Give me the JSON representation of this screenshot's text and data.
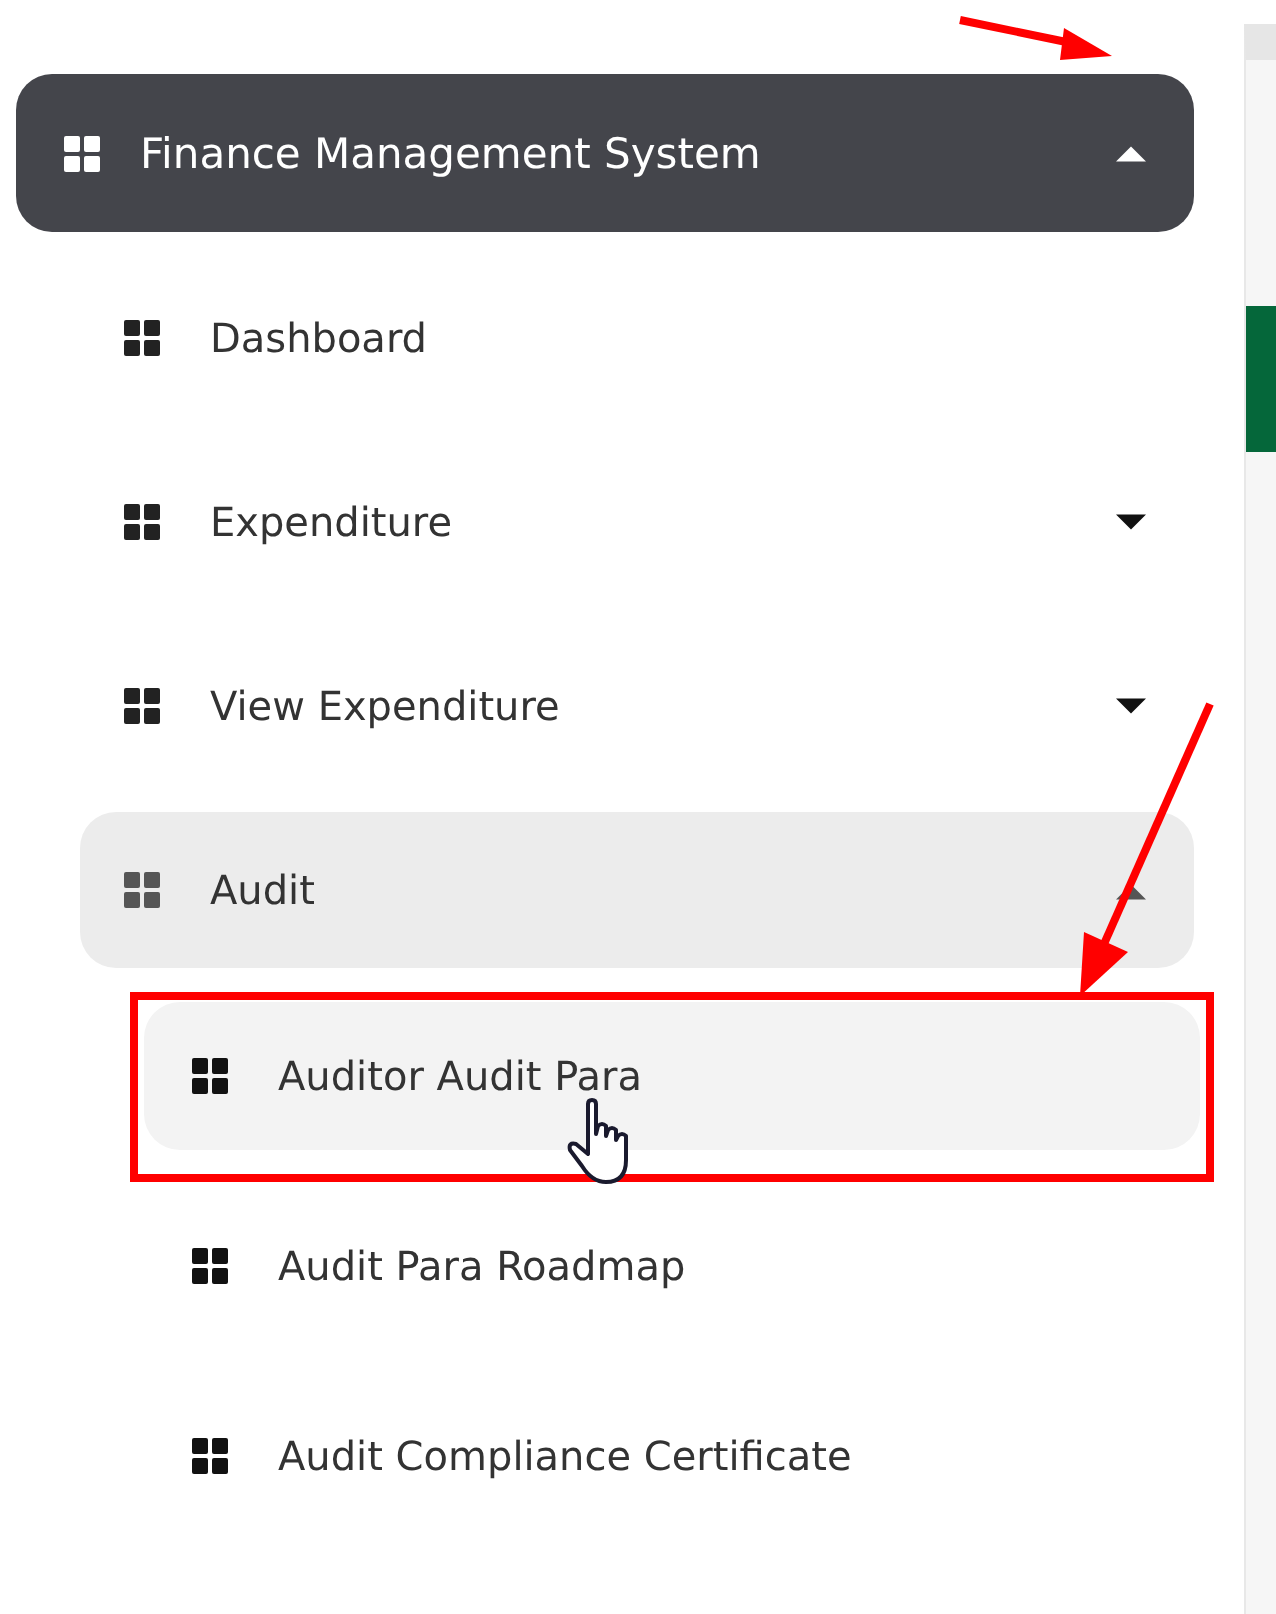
{
  "menu": {
    "title": "Finance Management System",
    "expanded": true,
    "items": [
      {
        "label": "Dashboard",
        "kind": "link"
      },
      {
        "label": "Expenditure",
        "kind": "group",
        "expanded": false
      },
      {
        "label": "View Expenditure",
        "kind": "group",
        "expanded": false
      },
      {
        "label": "Audit",
        "kind": "group",
        "expanded": true,
        "children": [
          {
            "label": "Auditor Audit Para",
            "hovered": true,
            "highlighted": true
          },
          {
            "label": "Audit Para Roadmap",
            "hovered": false,
            "highlighted": false
          },
          {
            "label": "Audit Compliance Certificate",
            "hovered": false,
            "highlighted": false
          }
        ]
      }
    ]
  }
}
